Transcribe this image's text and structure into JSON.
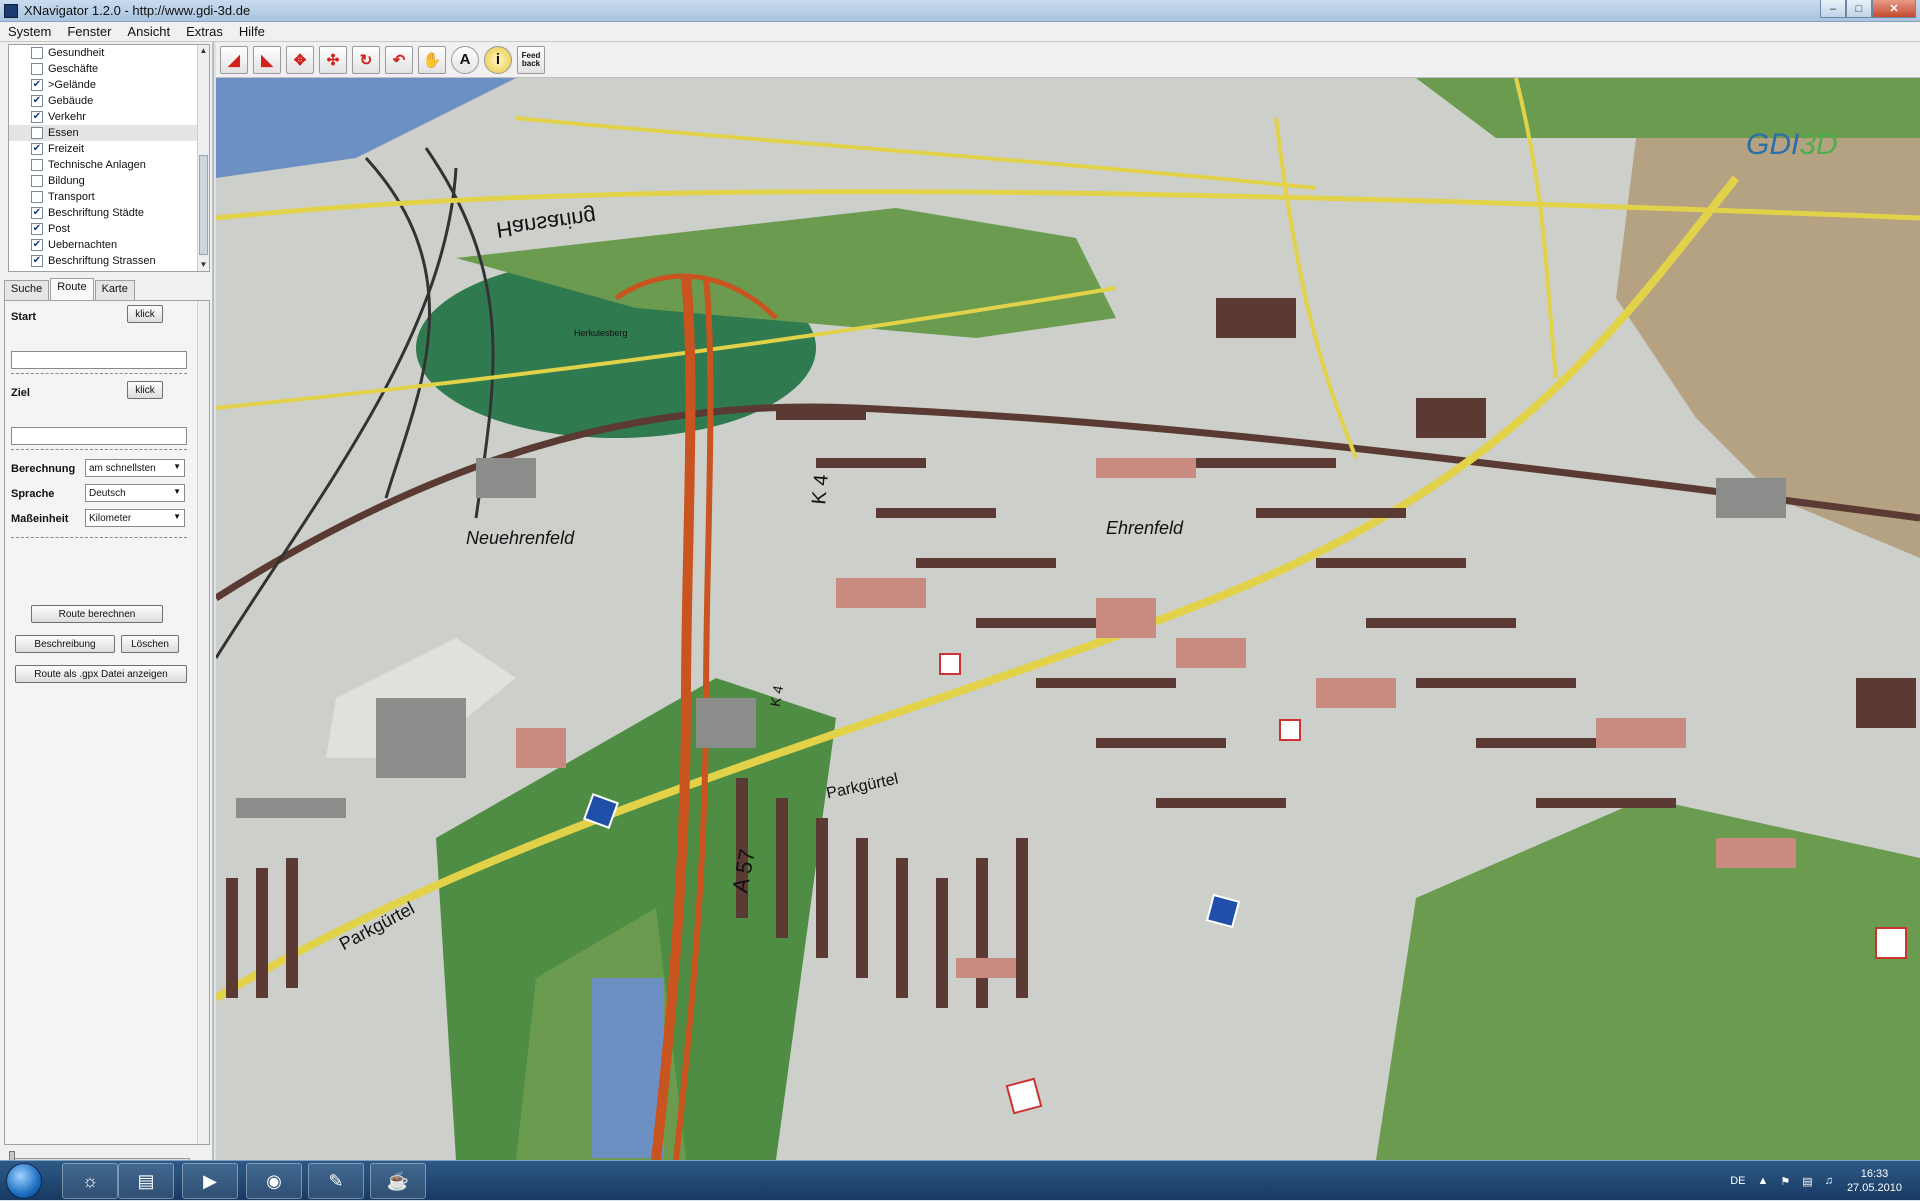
{
  "window": {
    "title": "XNavigator 1.2.0 - http://www.gdi-3d.de"
  },
  "menu": {
    "items": [
      "System",
      "Fenster",
      "Ansicht",
      "Extras",
      "Hilfe"
    ]
  },
  "layers": {
    "items": [
      {
        "label": "Gesundheit",
        "checked": false
      },
      {
        "label": "Geschäfte",
        "checked": false
      },
      {
        "label": ">Gelände",
        "checked": true
      },
      {
        "label": "Gebäude",
        "checked": true
      },
      {
        "label": "Verkehr",
        "checked": true
      },
      {
        "label": "Essen",
        "checked": false
      },
      {
        "label": "Freizeit",
        "checked": true
      },
      {
        "label": "Technische Anlagen",
        "checked": false
      },
      {
        "label": "Bildung",
        "checked": false
      },
      {
        "label": "Transport",
        "checked": false
      },
      {
        "label": "Beschriftung Städte",
        "checked": true
      },
      {
        "label": "Post",
        "checked": true
      },
      {
        "label": "Uebernachten",
        "checked": true
      },
      {
        "label": "Beschriftung Strassen",
        "checked": true
      }
    ],
    "selected_index": 5
  },
  "tabs": {
    "items": [
      "Suche",
      "Route",
      "Karte"
    ],
    "active_index": 1
  },
  "route": {
    "start_label": "Start",
    "ziel_label": "Ziel",
    "klick_label": "klick",
    "start_value": "",
    "ziel_value": "",
    "berechnung_label": "Berechnung",
    "berechnung_value": "am schnellsten",
    "sprache_label": "Sprache",
    "sprache_value": "Deutsch",
    "masseinheit_label": "Maßeinheit",
    "masseinheit_value": "Kilometer",
    "calc_button": "Route berechnen",
    "desc_button": "Beschreibung",
    "delete_button": "Löschen",
    "gpx_button": "Route als .gpx Datei anzeigen"
  },
  "toolbar": {
    "feedback_label": "Feed back",
    "text_tool_label": "A",
    "info_tool_label": "i"
  },
  "map": {
    "labels": {
      "district_1": "Neuehrenfeld",
      "district_2": "Ehrenfeld",
      "road_1": "Hansaring",
      "road_2": "Parkgürtel",
      "road_3": "Parkgürtel",
      "highway_1": "A 57",
      "highway_2": "K 4",
      "highway_3": "K 4",
      "poi_1": "Herkulesberg"
    },
    "logo_main": "GDI",
    "logo_accent": "3D",
    "colors": {
      "ground": "#cdcfcb",
      "park": "#5f9a4a",
      "water": "#6c8fc4",
      "road_yellow": "#e2d24a",
      "highway": "#c9541f",
      "building_dark": "#5a3a33",
      "building_pink": "#c98a80"
    }
  },
  "taskbar": {
    "language": "DE",
    "time": "16:33",
    "date": "27.05.2010"
  }
}
